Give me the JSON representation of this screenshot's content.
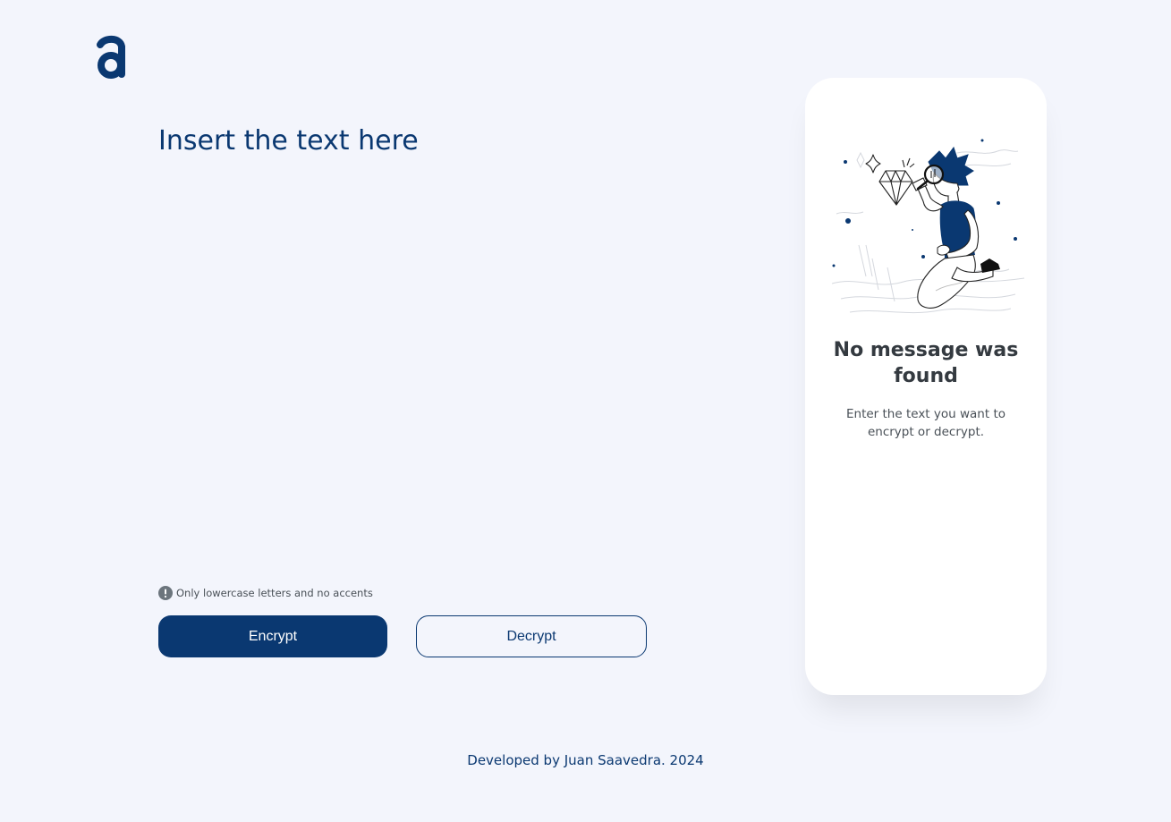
{
  "logo": {
    "icon": "alura-a-logo-icon",
    "color": "#0a3871"
  },
  "input": {
    "placeholder": "Insert the text here",
    "value": ""
  },
  "hint": {
    "icon": "exclamation-circle-icon",
    "text": "Only lowercase letters and no accents"
  },
  "buttons": {
    "encrypt_label": "Encrypt",
    "decrypt_label": "Decrypt"
  },
  "output_panel": {
    "illustration": "person-with-magnifying-glass-illustration",
    "title": "No message was found",
    "text": "Enter the text you want to encrypt or decrypt."
  },
  "footer": {
    "text": "Developed by Juan Saavedra. 2024"
  },
  "colors": {
    "primary": "#0a3871",
    "background": "#f3f5fc",
    "panel": "#ffffff",
    "title_text": "#343a40",
    "body_text": "#495057"
  }
}
